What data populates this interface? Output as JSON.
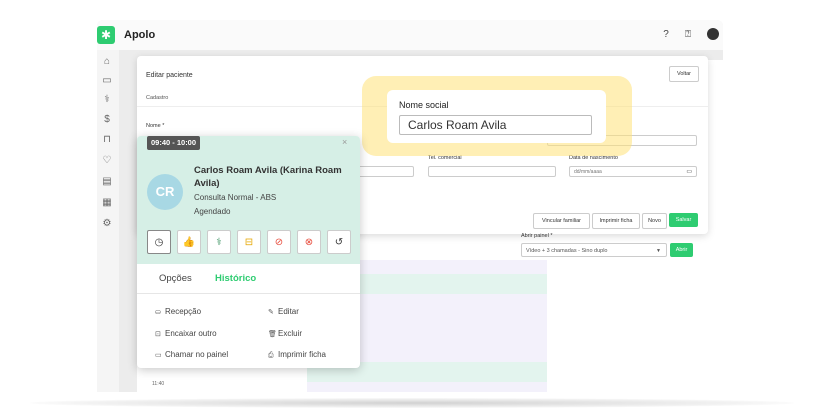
{
  "app": {
    "title": "Apolo",
    "logo_glyph": "✱",
    "accent": "#2ecc71"
  },
  "topbar": {
    "icons": [
      "help-icon",
      "chat-icon",
      "user-avatar"
    ],
    "help_glyph": "?",
    "chat_glyph": "⍰"
  },
  "sidebar": {
    "icons": [
      {
        "name": "home-icon",
        "glyph": "⌂"
      },
      {
        "name": "calendar-icon",
        "glyph": "▭"
      },
      {
        "name": "stethoscope-icon",
        "glyph": "⚕"
      },
      {
        "name": "dollar-icon",
        "glyph": "$"
      },
      {
        "name": "bag-icon",
        "glyph": "⊓"
      },
      {
        "name": "heart-icon",
        "glyph": "♡"
      },
      {
        "name": "report-icon",
        "glyph": "▤"
      },
      {
        "name": "table-icon",
        "glyph": "▦"
      },
      {
        "name": "settings-icon",
        "glyph": "⚙"
      }
    ]
  },
  "modal": {
    "title": "Editar paciente",
    "back_label": "Voltar",
    "tab_label": "Cadastro",
    "name_label": "Nome *",
    "phone_label": "Tel. comercial",
    "birth_label": "Data de nascimento",
    "birth_placeholder": "dd/mm/aaaa",
    "buttons": {
      "link_family": "Vincular familiar",
      "print": "Imprimir ficha",
      "new": "Novo",
      "save": "Salvar"
    }
  },
  "highlight": {
    "label": "Nome social",
    "value": "Carlos Roam Avila"
  },
  "panel": {
    "label": "Abrir painel *",
    "select_value": "Vídeo + 3 chamadas - Sino duplo",
    "open_button": "Abrir"
  },
  "schedule": {
    "time_label": "11:40"
  },
  "appointment": {
    "time": "09:40 - 10:00",
    "initials": "CR",
    "patient": "Carlos Roam Avila (Karina Roam Avila)",
    "service": "Consulta Normal - ABS",
    "status": "Agendado",
    "close_glyph": "×",
    "actions": [
      {
        "name": "clock-icon",
        "glyph": "◷",
        "color": "#333333",
        "active": true
      },
      {
        "name": "thumbs-up-icon",
        "glyph": "👍",
        "color": "#2ecc71"
      },
      {
        "name": "stethoscope-icon",
        "glyph": "⚕",
        "color": "#2e8b57"
      },
      {
        "name": "inbox-icon",
        "glyph": "⊟",
        "color": "#e6a700"
      },
      {
        "name": "cancel-icon",
        "glyph": "⊘",
        "color": "#e74c3c"
      },
      {
        "name": "close-circle-icon",
        "glyph": "⊗",
        "color": "#e74c3c"
      },
      {
        "name": "history-icon",
        "glyph": "↺",
        "color": "#333333"
      }
    ],
    "tabs": {
      "options": "Opções",
      "history": "Histórico"
    },
    "menu": {
      "reception": "Recepção",
      "edit": "Editar",
      "fit_other": "Encaixar outro",
      "delete": "Excluir",
      "call_panel": "Chamar no painel",
      "print_form": "Imprimir ficha"
    }
  }
}
